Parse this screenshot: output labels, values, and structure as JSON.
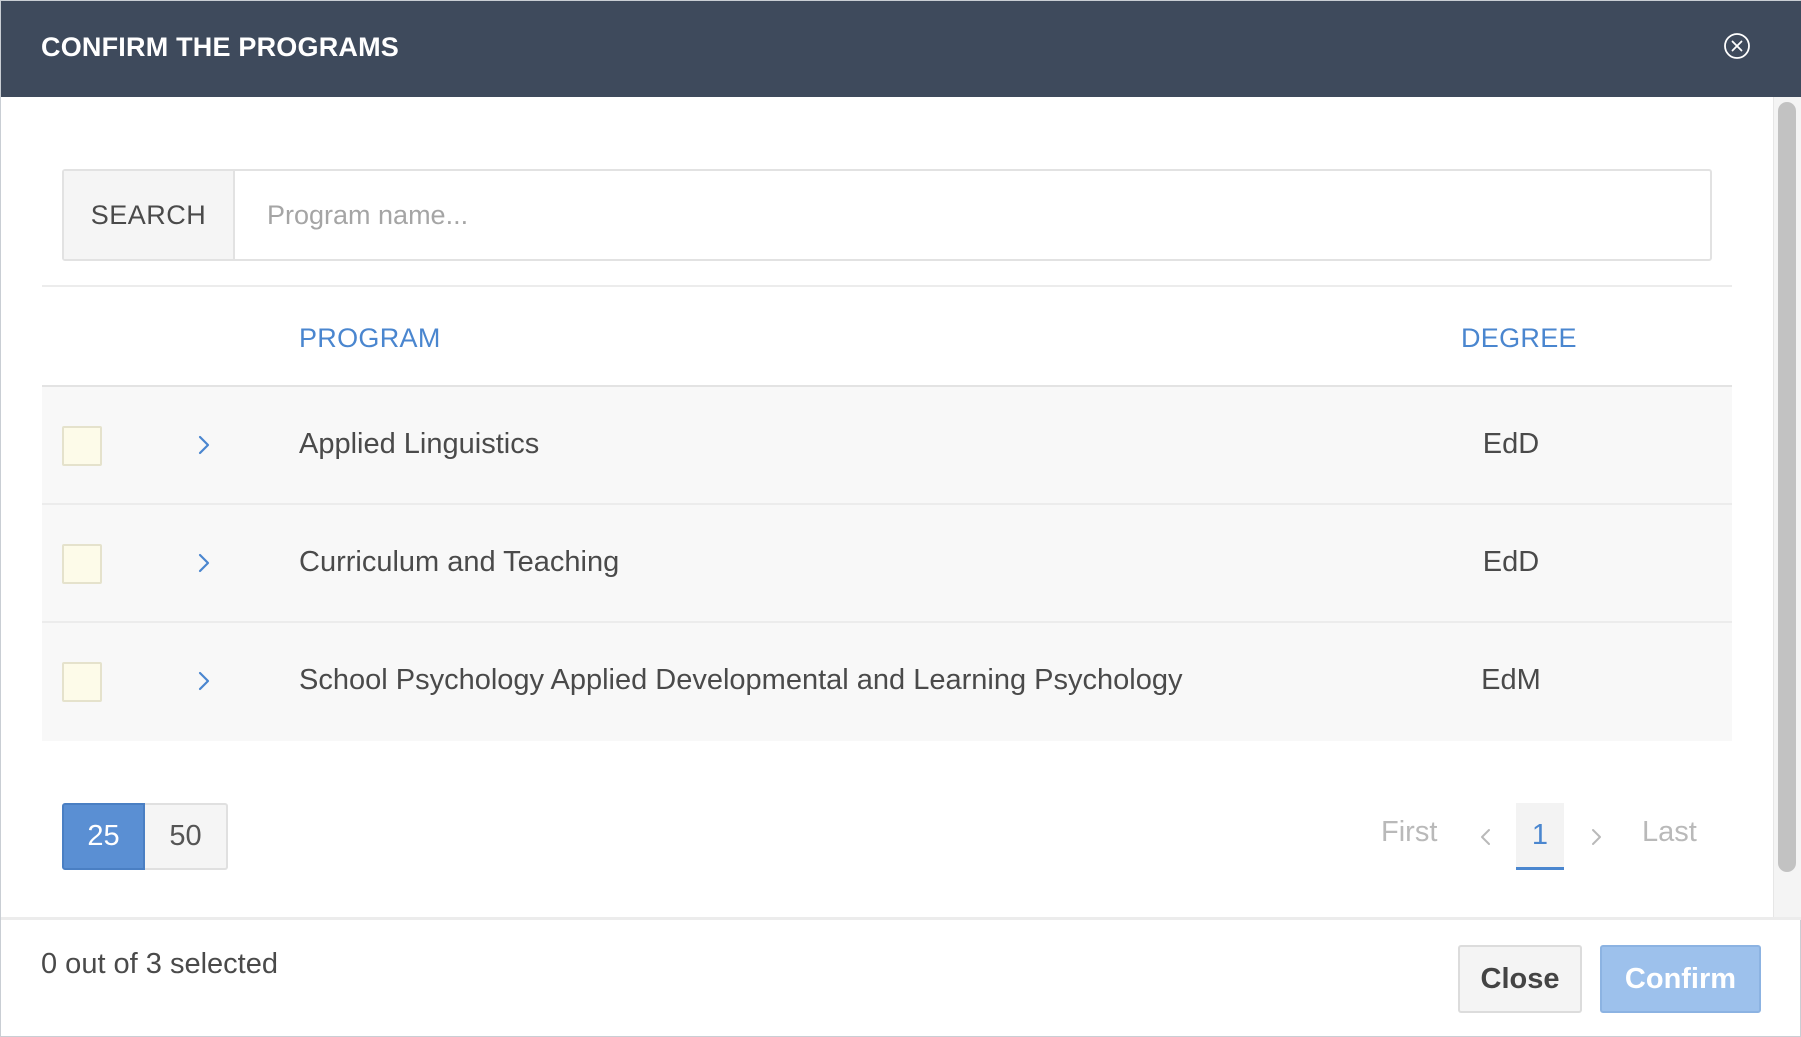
{
  "dialog": {
    "title": "CONFIRM THE PROGRAMS",
    "close_icon": "close-circle-icon"
  },
  "search": {
    "label": "SEARCH",
    "placeholder": "Program name...",
    "value": ""
  },
  "table": {
    "columns": {
      "program": "PROGRAM",
      "degree": "DEGREE"
    },
    "rows": [
      {
        "program": "Applied Linguistics",
        "degree": "EdD",
        "checked": false
      },
      {
        "program": "Curriculum and Teaching",
        "degree": "EdD",
        "checked": false
      },
      {
        "program": "School Psychology Applied Developmental and Learning Psychology",
        "degree": "EdM",
        "checked": false
      }
    ]
  },
  "pagination": {
    "page_sizes": [
      "25",
      "50"
    ],
    "selected_page_size": "25",
    "first": "First",
    "last": "Last",
    "current_page": "1",
    "prev_icon": "chevron-left-icon",
    "next_icon": "chevron-right-icon"
  },
  "footer": {
    "selected_text": "0 out of 3 selected",
    "close_label": "Close",
    "confirm_label": "Confirm"
  },
  "colors": {
    "header_bg": "#3e4a5c",
    "accent": "#4a86cf",
    "confirm_disabled": "#9dc1ec",
    "checkbox_fill": "#fdfbe9"
  }
}
